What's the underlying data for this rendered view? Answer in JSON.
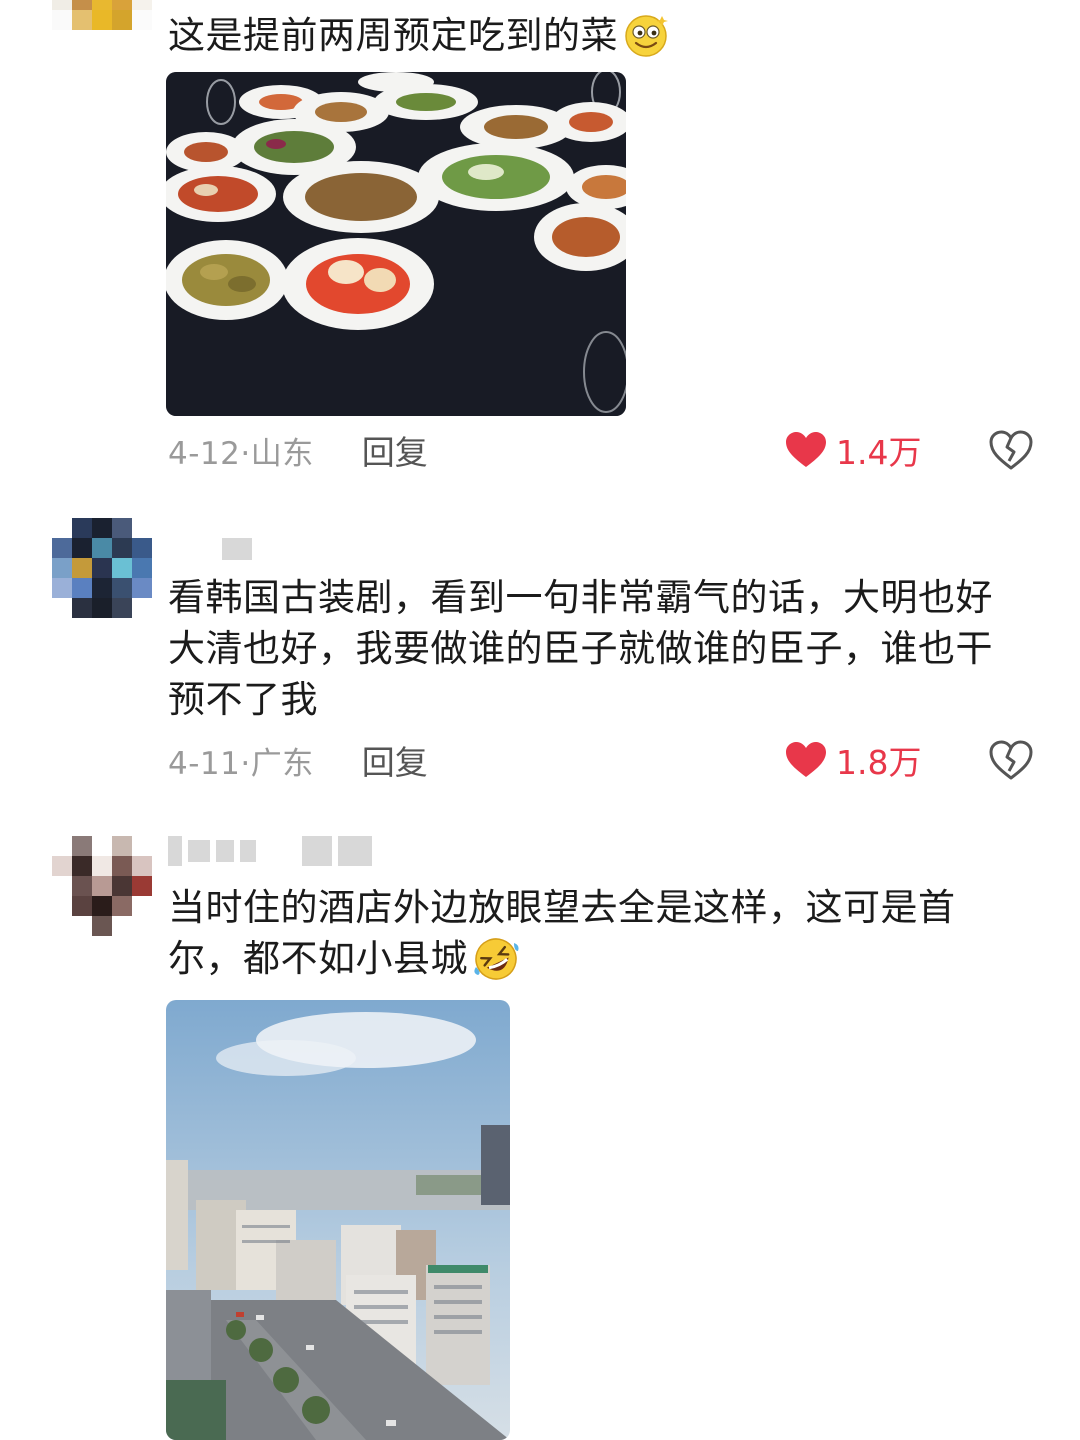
{
  "comments": [
    {
      "text": "这是提前两周预定吃到的菜",
      "date": "4-12·山东",
      "reply_label": "回复",
      "likes": "1.4万",
      "emoji": "smiling-star-emoji",
      "image": "food-table-photo"
    },
    {
      "text": "看韩国古装剧，看到一句非常霸气的话，大明也好大清也好，我要做谁的臣子就做谁的臣子，谁也干预不了我",
      "date": "4-11·广东",
      "reply_label": "回复",
      "likes": "1.8万"
    },
    {
      "text": "当时住的酒店外边放眼望去全是这样，这可是首尔，都不如小县城",
      "emoji": "rolling-laughing-emoji",
      "image": "city-view-photo"
    }
  ],
  "colors": {
    "like_red": "#e8374a",
    "meta_gray": "#9a9a9a",
    "text": "#1b1b1b"
  },
  "icons": [
    "heart-icon",
    "broken-heart-icon"
  ]
}
